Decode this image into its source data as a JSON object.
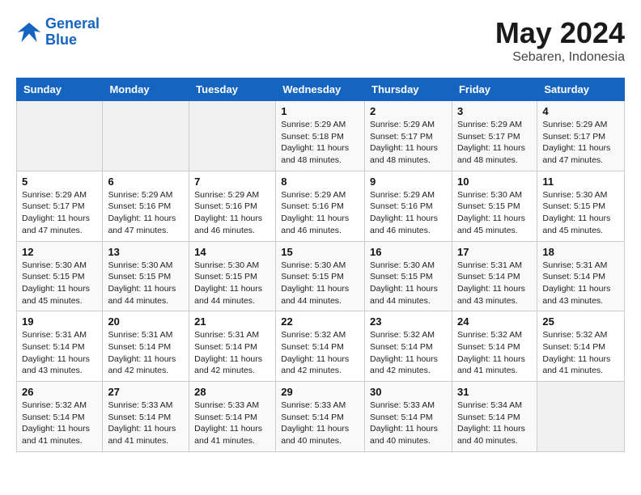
{
  "header": {
    "logo_line1": "General",
    "logo_line2": "Blue",
    "month": "May 2024",
    "location": "Sebaren, Indonesia"
  },
  "weekdays": [
    "Sunday",
    "Monday",
    "Tuesday",
    "Wednesday",
    "Thursday",
    "Friday",
    "Saturday"
  ],
  "weeks": [
    [
      {
        "day": "",
        "info": ""
      },
      {
        "day": "",
        "info": ""
      },
      {
        "day": "",
        "info": ""
      },
      {
        "day": "1",
        "info": "Sunrise: 5:29 AM\nSunset: 5:18 PM\nDaylight: 11 hours\nand 48 minutes."
      },
      {
        "day": "2",
        "info": "Sunrise: 5:29 AM\nSunset: 5:17 PM\nDaylight: 11 hours\nand 48 minutes."
      },
      {
        "day": "3",
        "info": "Sunrise: 5:29 AM\nSunset: 5:17 PM\nDaylight: 11 hours\nand 48 minutes."
      },
      {
        "day": "4",
        "info": "Sunrise: 5:29 AM\nSunset: 5:17 PM\nDaylight: 11 hours\nand 47 minutes."
      }
    ],
    [
      {
        "day": "5",
        "info": "Sunrise: 5:29 AM\nSunset: 5:17 PM\nDaylight: 11 hours\nand 47 minutes."
      },
      {
        "day": "6",
        "info": "Sunrise: 5:29 AM\nSunset: 5:16 PM\nDaylight: 11 hours\nand 47 minutes."
      },
      {
        "day": "7",
        "info": "Sunrise: 5:29 AM\nSunset: 5:16 PM\nDaylight: 11 hours\nand 46 minutes."
      },
      {
        "day": "8",
        "info": "Sunrise: 5:29 AM\nSunset: 5:16 PM\nDaylight: 11 hours\nand 46 minutes."
      },
      {
        "day": "9",
        "info": "Sunrise: 5:29 AM\nSunset: 5:16 PM\nDaylight: 11 hours\nand 46 minutes."
      },
      {
        "day": "10",
        "info": "Sunrise: 5:30 AM\nSunset: 5:15 PM\nDaylight: 11 hours\nand 45 minutes."
      },
      {
        "day": "11",
        "info": "Sunrise: 5:30 AM\nSunset: 5:15 PM\nDaylight: 11 hours\nand 45 minutes."
      }
    ],
    [
      {
        "day": "12",
        "info": "Sunrise: 5:30 AM\nSunset: 5:15 PM\nDaylight: 11 hours\nand 45 minutes."
      },
      {
        "day": "13",
        "info": "Sunrise: 5:30 AM\nSunset: 5:15 PM\nDaylight: 11 hours\nand 44 minutes."
      },
      {
        "day": "14",
        "info": "Sunrise: 5:30 AM\nSunset: 5:15 PM\nDaylight: 11 hours\nand 44 minutes."
      },
      {
        "day": "15",
        "info": "Sunrise: 5:30 AM\nSunset: 5:15 PM\nDaylight: 11 hours\nand 44 minutes."
      },
      {
        "day": "16",
        "info": "Sunrise: 5:30 AM\nSunset: 5:15 PM\nDaylight: 11 hours\nand 44 minutes."
      },
      {
        "day": "17",
        "info": "Sunrise: 5:31 AM\nSunset: 5:14 PM\nDaylight: 11 hours\nand 43 minutes."
      },
      {
        "day": "18",
        "info": "Sunrise: 5:31 AM\nSunset: 5:14 PM\nDaylight: 11 hours\nand 43 minutes."
      }
    ],
    [
      {
        "day": "19",
        "info": "Sunrise: 5:31 AM\nSunset: 5:14 PM\nDaylight: 11 hours\nand 43 minutes."
      },
      {
        "day": "20",
        "info": "Sunrise: 5:31 AM\nSunset: 5:14 PM\nDaylight: 11 hours\nand 42 minutes."
      },
      {
        "day": "21",
        "info": "Sunrise: 5:31 AM\nSunset: 5:14 PM\nDaylight: 11 hours\nand 42 minutes."
      },
      {
        "day": "22",
        "info": "Sunrise: 5:32 AM\nSunset: 5:14 PM\nDaylight: 11 hours\nand 42 minutes."
      },
      {
        "day": "23",
        "info": "Sunrise: 5:32 AM\nSunset: 5:14 PM\nDaylight: 11 hours\nand 42 minutes."
      },
      {
        "day": "24",
        "info": "Sunrise: 5:32 AM\nSunset: 5:14 PM\nDaylight: 11 hours\nand 41 minutes."
      },
      {
        "day": "25",
        "info": "Sunrise: 5:32 AM\nSunset: 5:14 PM\nDaylight: 11 hours\nand 41 minutes."
      }
    ],
    [
      {
        "day": "26",
        "info": "Sunrise: 5:32 AM\nSunset: 5:14 PM\nDaylight: 11 hours\nand 41 minutes."
      },
      {
        "day": "27",
        "info": "Sunrise: 5:33 AM\nSunset: 5:14 PM\nDaylight: 11 hours\nand 41 minutes."
      },
      {
        "day": "28",
        "info": "Sunrise: 5:33 AM\nSunset: 5:14 PM\nDaylight: 11 hours\nand 41 minutes."
      },
      {
        "day": "29",
        "info": "Sunrise: 5:33 AM\nSunset: 5:14 PM\nDaylight: 11 hours\nand 40 minutes."
      },
      {
        "day": "30",
        "info": "Sunrise: 5:33 AM\nSunset: 5:14 PM\nDaylight: 11 hours\nand 40 minutes."
      },
      {
        "day": "31",
        "info": "Sunrise: 5:34 AM\nSunset: 5:14 PM\nDaylight: 11 hours\nand 40 minutes."
      },
      {
        "day": "",
        "info": ""
      }
    ]
  ]
}
